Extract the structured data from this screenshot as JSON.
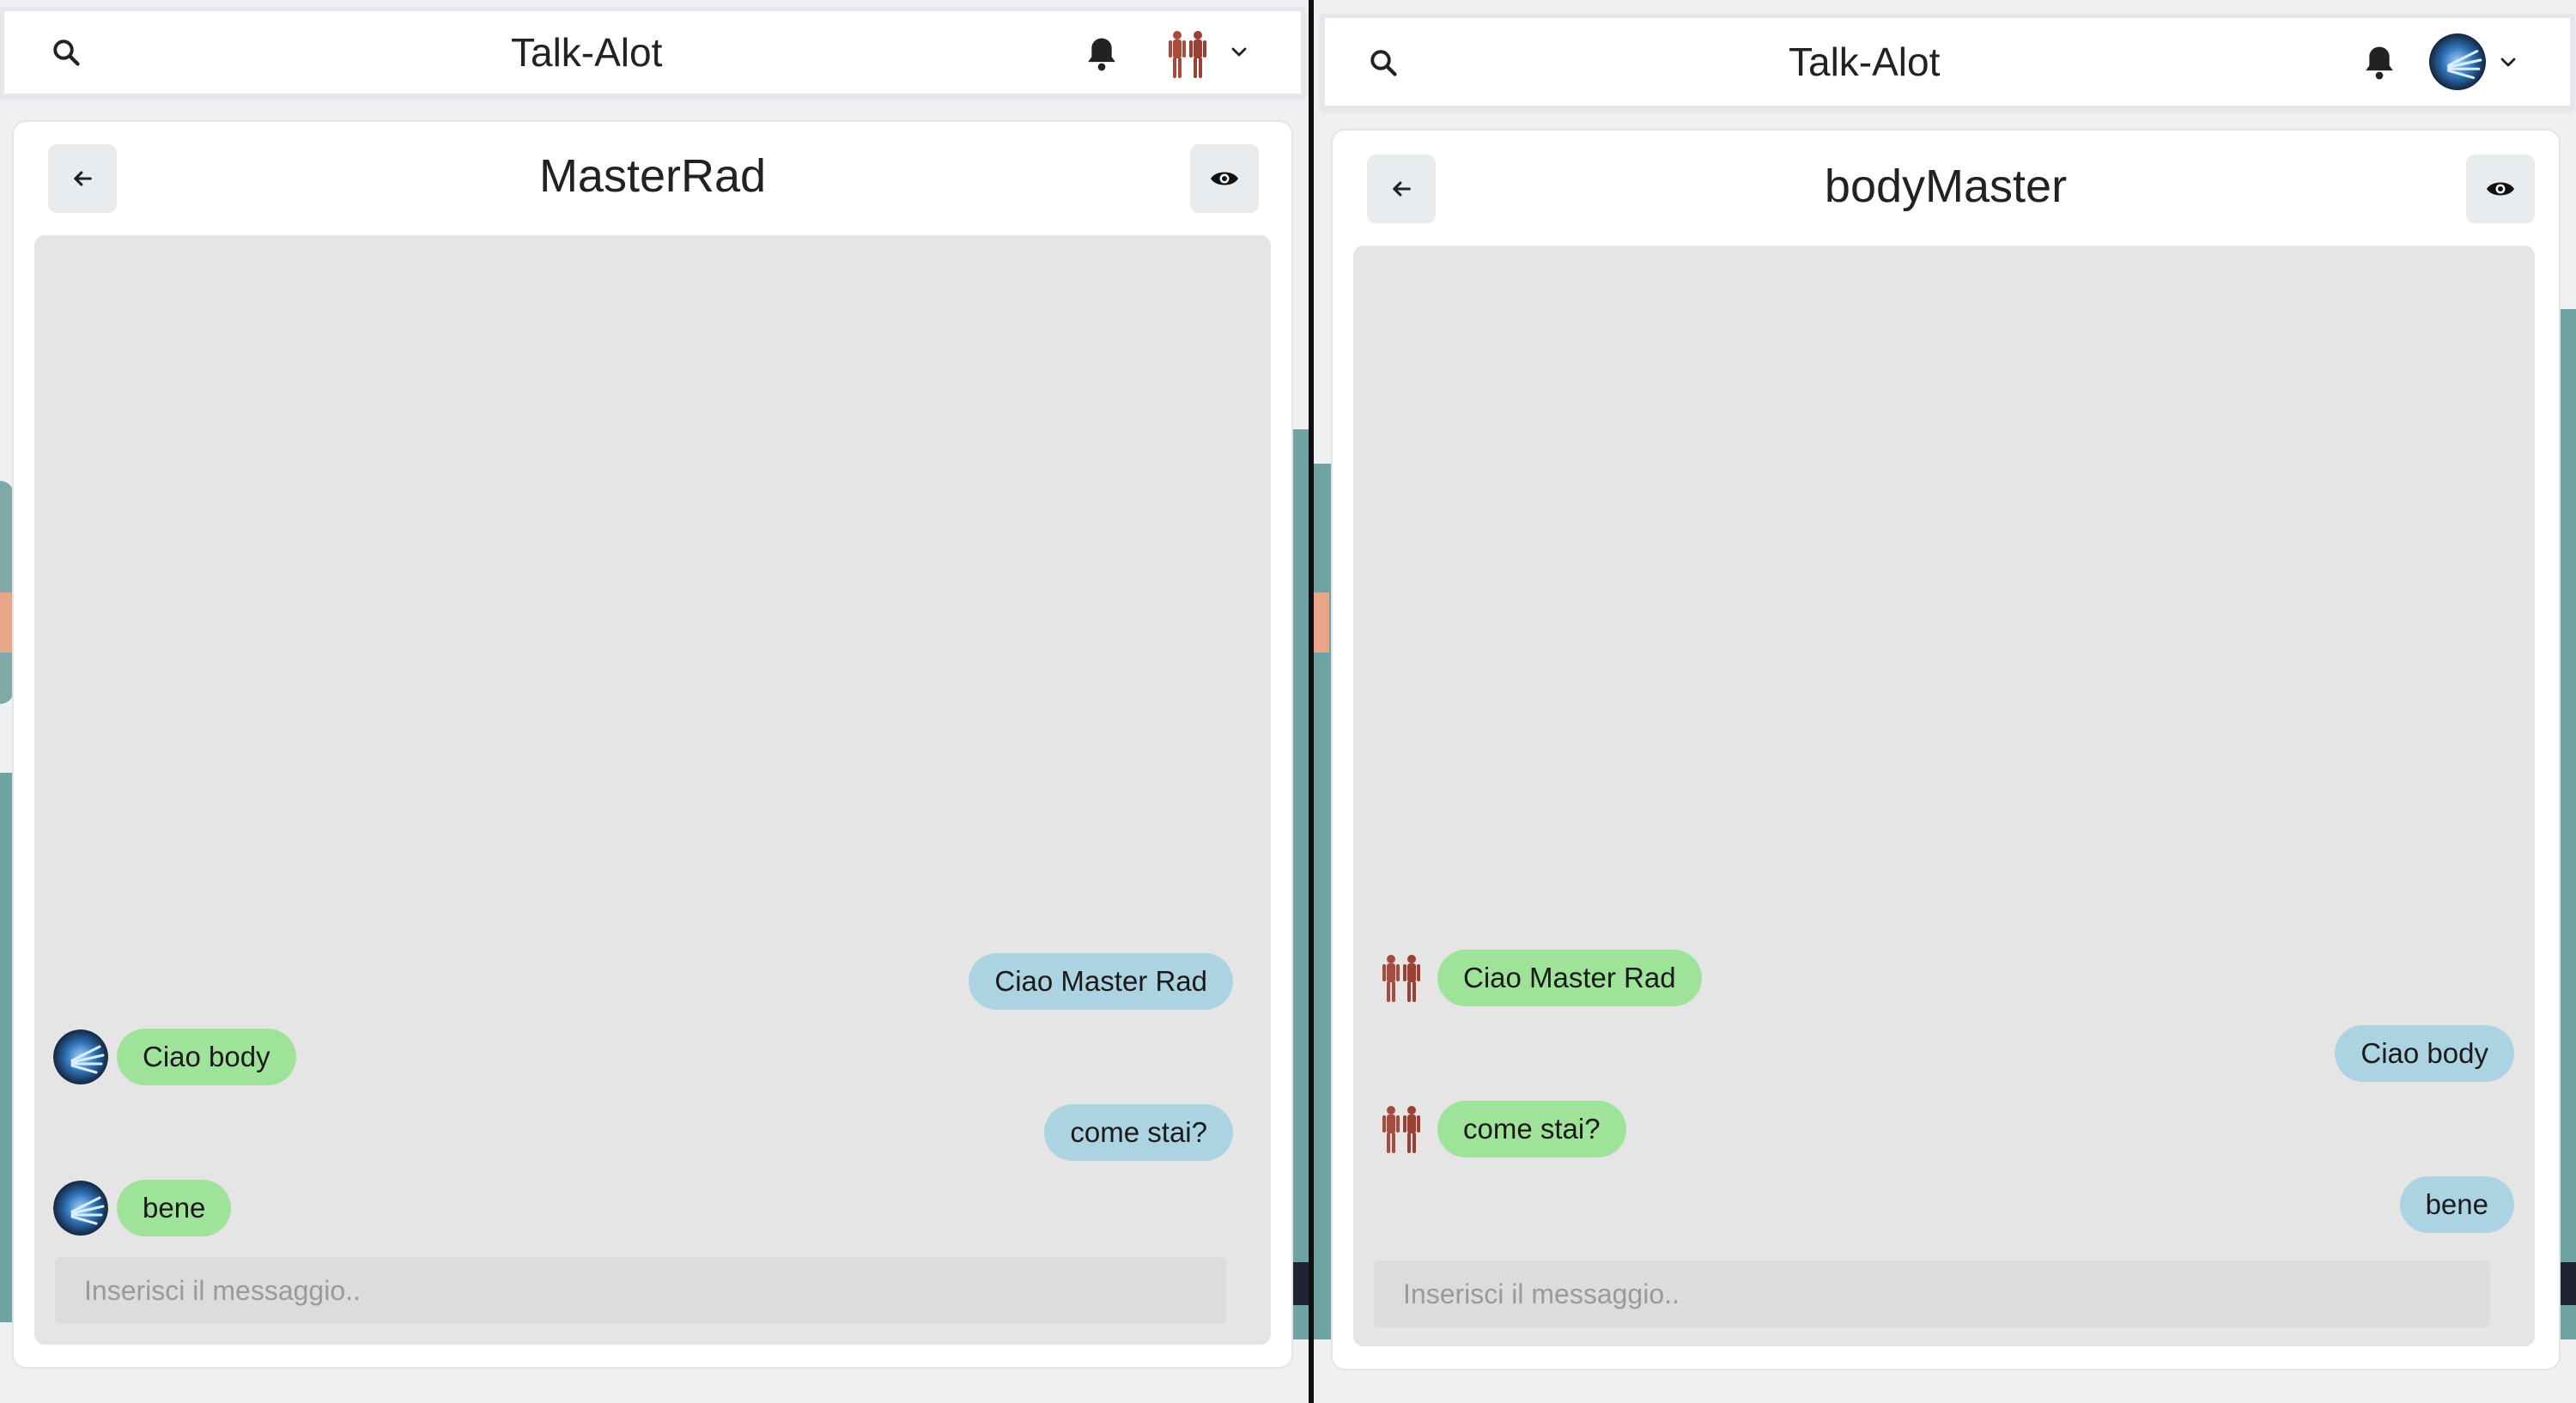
{
  "left": {
    "app_title": "Talk-Alot",
    "chat_title": "MasterRad",
    "input_placeholder": "Inserisci il messaggio..",
    "messages": [
      {
        "text": "Ciao Master Rad",
        "side": "right",
        "color": "blue"
      },
      {
        "text": "Ciao body",
        "side": "left",
        "color": "green",
        "avatar": "xray-hand-avatar"
      },
      {
        "text": "come stai?",
        "side": "right",
        "color": "blue"
      },
      {
        "text": "bene",
        "side": "left",
        "color": "green",
        "avatar": "xray-hand-avatar"
      }
    ]
  },
  "right": {
    "app_title": "Talk-Alot",
    "chat_title": "bodyMaster",
    "input_placeholder": "Inserisci il messaggio..",
    "messages": [
      {
        "text": "Ciao Master Rad",
        "side": "left",
        "color": "green",
        "avatar": "anatomy-body-avatar"
      },
      {
        "text": "Ciao body",
        "side": "right",
        "color": "blue"
      },
      {
        "text": "come stai?",
        "side": "left",
        "color": "green",
        "avatar": "anatomy-body-avatar"
      },
      {
        "text": "bene",
        "side": "right",
        "color": "blue"
      }
    ]
  },
  "icons": {
    "search": "search-icon",
    "bell": "bell-icon",
    "chevron": "chevron-down-icon",
    "back": "arrow-left-icon",
    "eye": "eye-icon"
  },
  "colors": {
    "bubble_green": "#9fe39b",
    "bubble_blue": "#acd3e1",
    "chat_bg": "#e5e5e5",
    "button_bg": "#e9ecef"
  }
}
